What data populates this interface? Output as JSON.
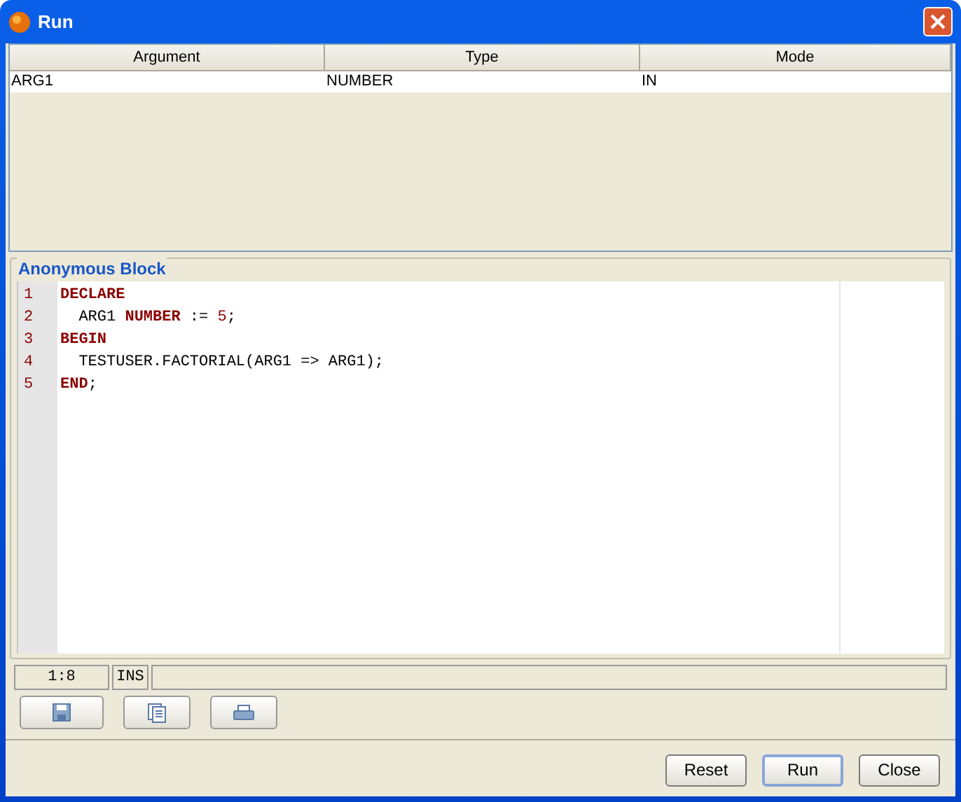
{
  "window": {
    "title": "Run"
  },
  "table": {
    "columns": [
      "Argument",
      "Type",
      "Mode"
    ],
    "rows": [
      [
        "ARG1",
        "NUMBER",
        "IN"
      ]
    ]
  },
  "editor": {
    "title": "Anonymous Block",
    "lines": [
      {
        "number": "1",
        "tokens": [
          {
            "kind": "keyword",
            "text": "DECLARE"
          }
        ]
      },
      {
        "number": "2",
        "tokens": [
          {
            "kind": "plain",
            "text": "  ARG1 "
          },
          {
            "kind": "keyword",
            "text": "NUMBER"
          },
          {
            "kind": "plain",
            "text": " := "
          },
          {
            "kind": "number",
            "text": "5"
          },
          {
            "kind": "plain",
            "text": ";"
          }
        ]
      },
      {
        "number": "3",
        "tokens": [
          {
            "kind": "keyword",
            "text": "BEGIN"
          }
        ]
      },
      {
        "number": "4",
        "tokens": [
          {
            "kind": "plain",
            "text": "  TESTUSER.FACTORIAL(ARG1 => ARG1);"
          }
        ]
      },
      {
        "number": "5",
        "tokens": [
          {
            "kind": "keyword",
            "text": "END"
          },
          {
            "kind": "plain",
            "text": ";"
          }
        ]
      }
    ],
    "status": {
      "position": "1:8",
      "mode": "INS"
    }
  },
  "buttons": [
    {
      "label": "Reset",
      "selected": false
    },
    {
      "label": "Run",
      "selected": true
    },
    {
      "label": "Close",
      "selected": false
    }
  ]
}
